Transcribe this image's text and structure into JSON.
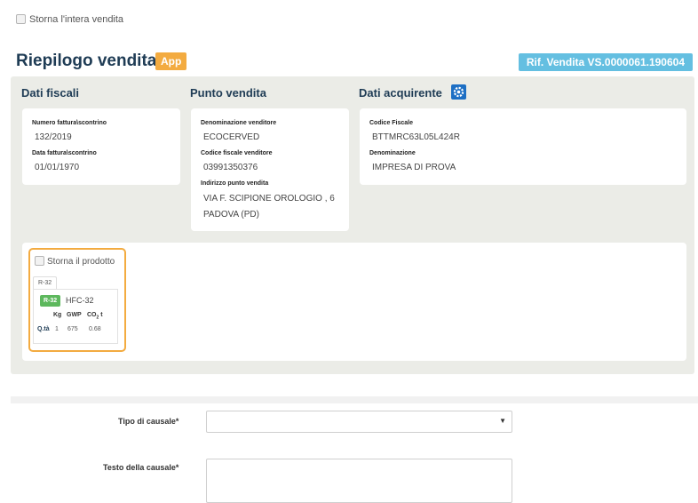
{
  "top_checkbox": {
    "label": "Storna l'intera vendita",
    "checked": false
  },
  "header": {
    "title": "Riepilogo vendita",
    "app_badge": "App",
    "reference": "Rif. Vendita VS.0000061.190604"
  },
  "colors": {
    "title": "#1f3c55",
    "app_badge": "#f3ab40",
    "reference_badge": "#64bfe1",
    "panel_bg": "#ebece7",
    "gas_badge": "#5db85d",
    "edit_icon": "#1d6fc4"
  },
  "sections": {
    "fiscali": {
      "title": "Dati fiscali",
      "fields": [
        {
          "label": "Numero fattura\\scontrino",
          "value": "132/2019"
        },
        {
          "label": "Data fattura\\scontrino",
          "value": "01/01/1970"
        }
      ]
    },
    "punto": {
      "title": "Punto vendita",
      "fields": [
        {
          "label": "Denominazione venditore",
          "value": "ECOCERVED"
        },
        {
          "label": "Codice fiscale venditore",
          "value": "03991350376"
        },
        {
          "label": "Indirizzo punto vendita",
          "value": "VIA F. SCIPIONE OROLOGIO , 6",
          "value2": "PADOVA (PD)"
        }
      ]
    },
    "acquirente": {
      "title": "Dati acquirente",
      "edit_icon": "gear-icon",
      "fields": [
        {
          "label": "Codice Fiscale",
          "value": "BTTMRC63L05L424R"
        },
        {
          "label": "Denominazione",
          "value": "IMPRESA DI PROVA"
        }
      ]
    }
  },
  "product": {
    "storna_label": "Storna il prodotto",
    "checked": false,
    "tab": "R-32",
    "gas_badge": "R-32",
    "gas_name": "HFC-32",
    "columns": [
      "Kg",
      "GWP",
      "CO"
    ],
    "co2_sub": "2",
    "co2_unit": "t",
    "row_label": "Q.tà",
    "values": [
      "1",
      "675",
      "0.68"
    ]
  },
  "form": {
    "tipo_label": "Tipo di causale*",
    "tipo_value": "",
    "select_arrow": "▼",
    "testo_label": "Testo della causale*",
    "testo_value": ""
  }
}
